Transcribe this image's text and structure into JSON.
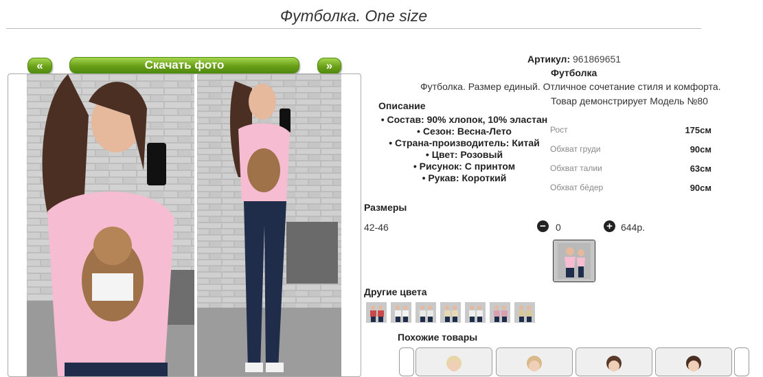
{
  "page": {
    "title": "Футболка. One size"
  },
  "gallery": {
    "prev_label": "«",
    "download_label": "Скачать фото",
    "next_label": "»"
  },
  "product": {
    "article_label": "Артикул:",
    "article_value": "961869651",
    "name": "Футболка",
    "description": "Футболка. Размер единый. Отличное сочетание стиля и комфорта.",
    "model_line": "Товар демонстрирует Модель №80"
  },
  "description_section": {
    "heading": "Описание",
    "attributes": [
      "Состав: 90% хлопок, 10% эластан",
      "Сезон: Весна-Лето",
      "Страна-производитель: Китай",
      "Цвет: Розовый",
      "Рисунок: С принтом",
      "Рукав: Короткий"
    ]
  },
  "measurements": [
    {
      "label": "Рост",
      "value": "175см"
    },
    {
      "label": "Обхват груди",
      "value": "90см"
    },
    {
      "label": "Обхват талии",
      "value": "63см"
    },
    {
      "label": "Обхват бёдер",
      "value": "90см"
    }
  ],
  "sizes": {
    "heading": "Размеры",
    "range": "42-46",
    "quantity": "0",
    "price": "644р."
  },
  "other_colors": {
    "heading": "Другие цвета",
    "count": 7
  },
  "similar": {
    "heading": "Похожие товары"
  },
  "colors": {
    "button_green": "#6aa018",
    "shirt_pink": "#f6bcd2",
    "brick": "#a9a9a9",
    "jeans": "#1f2c4a"
  }
}
